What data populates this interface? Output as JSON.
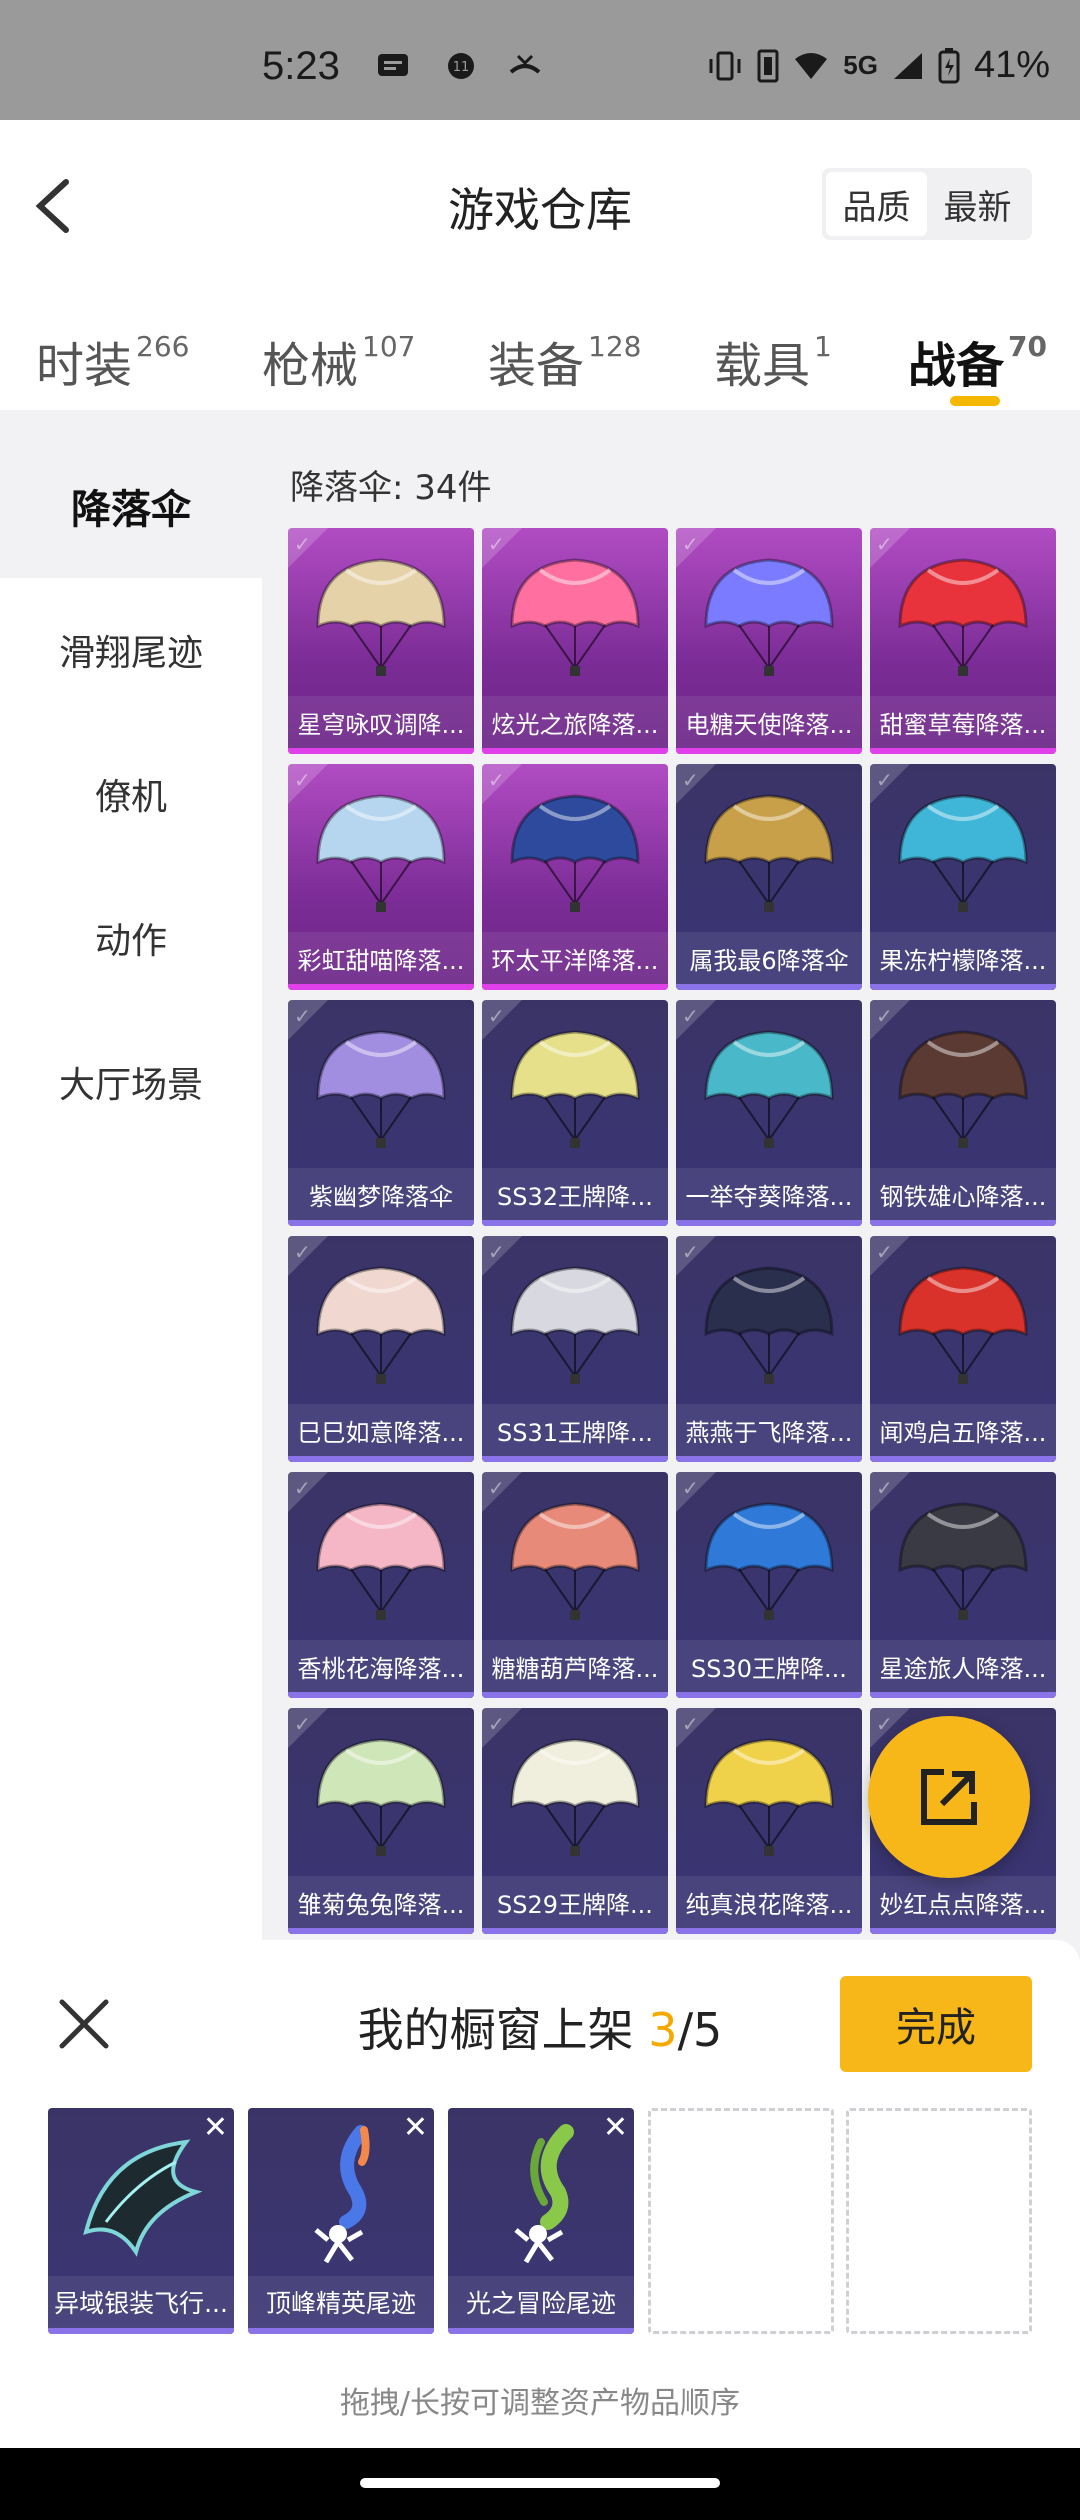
{
  "status_bar": {
    "time": "5:23",
    "network": "5G",
    "battery": "41%"
  },
  "header": {
    "title": "游戏仓库",
    "sort_options": [
      "品质",
      "最新"
    ],
    "active_sort": "品质"
  },
  "tabs": [
    {
      "label": "时装",
      "count": "266"
    },
    {
      "label": "枪械",
      "count": "107"
    },
    {
      "label": "装备",
      "count": "128"
    },
    {
      "label": "载具",
      "count": "1"
    },
    {
      "label": "战备",
      "count": "70"
    }
  ],
  "active_tab": "战备",
  "sidebar": {
    "items": [
      {
        "label": "降落伞"
      },
      {
        "label": "滑翔尾迹"
      },
      {
        "label": "僚机"
      },
      {
        "label": "动作"
      },
      {
        "label": "大厅场景"
      }
    ],
    "active": "降落伞"
  },
  "grid": {
    "title": "降落伞: 34件",
    "items": [
      {
        "name": "星穹咏叹调降...",
        "rarity": "epic",
        "color": "#e6d2a8"
      },
      {
        "name": "炫光之旅降落...",
        "rarity": "epic",
        "color": "#ff6fa0"
      },
      {
        "name": "电糖天使降落...",
        "rarity": "epic",
        "color": "#7a7bff"
      },
      {
        "name": "甜蜜草莓降落...",
        "rarity": "epic",
        "color": "#e8323c"
      },
      {
        "name": "彩虹甜喵降落...",
        "rarity": "epic",
        "color": "#b6d6f0"
      },
      {
        "name": "环太平洋降落...",
        "rarity": "epic",
        "color": "#2d4a9c"
      },
      {
        "name": "属我最6降落伞",
        "rarity": "rare",
        "color": "#c9a04a"
      },
      {
        "name": "果冻柠檬降落...",
        "rarity": "rare",
        "color": "#3fb6d8"
      },
      {
        "name": "紫幽梦降落伞",
        "rarity": "rare",
        "color": "#a28ee0"
      },
      {
        "name": "SS32王牌降...",
        "rarity": "rare",
        "color": "#e6e08a"
      },
      {
        "name": "一举夺葵降落...",
        "rarity": "rare",
        "color": "#49b9c9"
      },
      {
        "name": "钢铁雄心降落...",
        "rarity": "rare",
        "color": "#5a3a32"
      },
      {
        "name": "巳巳如意降落...",
        "rarity": "rare",
        "color": "#f0d8d0"
      },
      {
        "name": "SS31王牌降...",
        "rarity": "rare",
        "color": "#d8d8e0"
      },
      {
        "name": "燕燕于飞降落...",
        "rarity": "rare",
        "color": "#2a2f4e"
      },
      {
        "name": "闻鸡启五降落...",
        "rarity": "rare",
        "color": "#d8322a"
      },
      {
        "name": "香桃花海降落...",
        "rarity": "rare",
        "color": "#f5b6c6"
      },
      {
        "name": "糖糖葫芦降落...",
        "rarity": "rare",
        "color": "#e88a7a"
      },
      {
        "name": "SS30王牌降...",
        "rarity": "rare",
        "color": "#2f7ad8"
      },
      {
        "name": "星途旅人降落...",
        "rarity": "rare",
        "color": "#3a3a44"
      },
      {
        "name": "雏菊兔兔降落...",
        "rarity": "rare",
        "color": "#cfe6b8"
      },
      {
        "name": "SS29王牌降...",
        "rarity": "rare",
        "color": "#f0eedc"
      },
      {
        "name": "纯真浪花降落...",
        "rarity": "rare",
        "color": "#f0d24a"
      },
      {
        "name": "妙红点点降落...",
        "rarity": "rare",
        "color": "#c8384a"
      }
    ]
  },
  "showcase": {
    "title_prefix": "我的橱窗上架 ",
    "current": "3",
    "total": "/5",
    "done_label": "完成",
    "hint": "拖拽/长按可调整资产物品顺序",
    "slots": [
      {
        "name": "异域银装飞行...",
        "icon": "glider-wing-icon"
      },
      {
        "name": "顶峰精英尾迹",
        "icon": "trail-blue-icon"
      },
      {
        "name": "光之冒险尾迹",
        "icon": "trail-green-icon"
      }
    ]
  }
}
